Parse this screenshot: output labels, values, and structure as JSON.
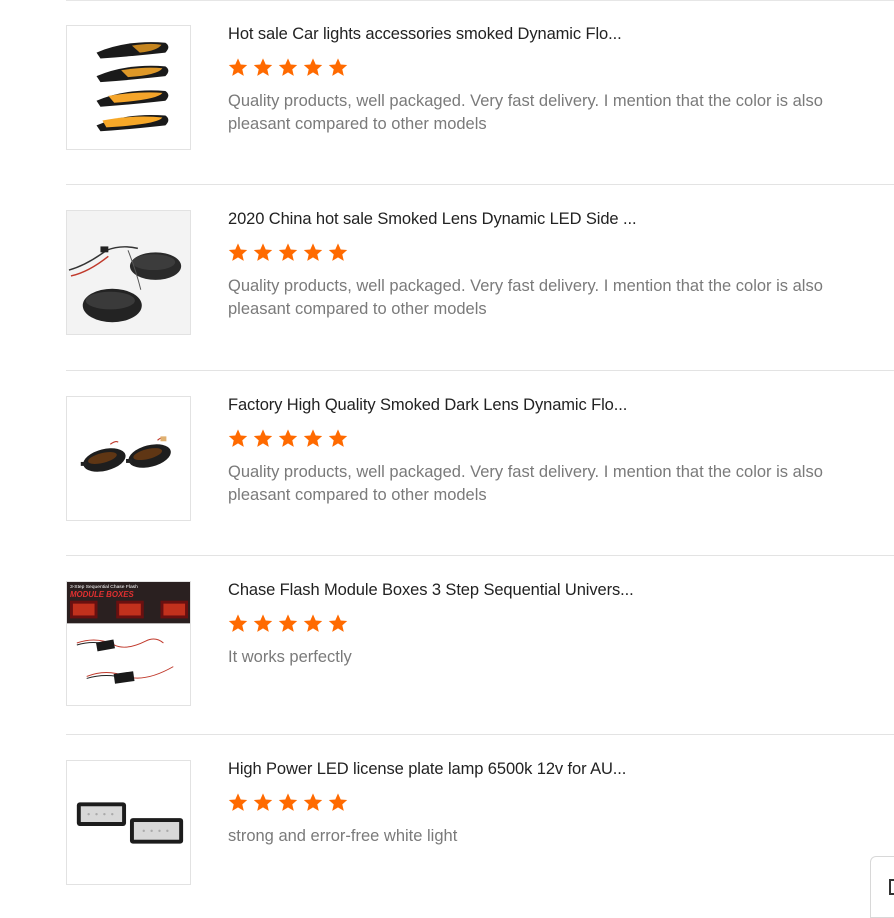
{
  "colors": {
    "star": "#ff6a00",
    "title": "#222222",
    "text": "#7a7a7a",
    "divider": "#e3e3e3"
  },
  "reviews": [
    {
      "product_title": "Hot sale Car lights accessories smoked Dynamic Flo...",
      "rating": 5,
      "text": "Quality products, well packaged. Very fast delivery. I mention that the color is also pleasant compared to other models",
      "image": "amber-side-marker-lights-icon"
    },
    {
      "product_title": "2020 China hot sale Smoked Lens Dynamic LED Side ...",
      "rating": 5,
      "text": "Quality products, well packaged. Very fast delivery. I mention that the color is also pleasant compared to other models",
      "image": "smoked-oval-side-lights-icon"
    },
    {
      "product_title": "Factory High Quality Smoked Dark Lens Dynamic Flo...",
      "rating": 5,
      "text": "Quality products, well packaged. Very fast delivery. I mention that the color is also pleasant compared to other models",
      "image": "dark-lens-side-lights-icon"
    },
    {
      "product_title": "Chase Flash Module Boxes 3 Step Sequential Univers...",
      "rating": 5,
      "text": "It works perfectly",
      "image": "module-boxes-icon",
      "image_caption_top": "3-Step Sequential Chase Flash",
      "image_caption": "MODULE BOXES"
    },
    {
      "product_title": "High Power LED license plate lamp 6500k 12v for AU...",
      "rating": 5,
      "text": "strong and error-free white light",
      "image": "license-plate-lamps-icon"
    }
  ]
}
